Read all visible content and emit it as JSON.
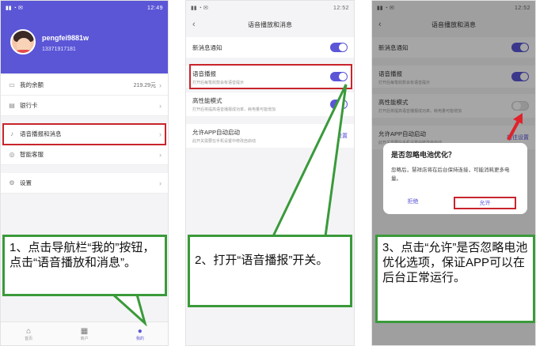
{
  "panel1": {
    "status_time": "12:49",
    "user": {
      "name": "pengfei9881w",
      "phone": "13371917181"
    },
    "menu_group1": [
      {
        "icon": "wallet-icon",
        "label": "我的余额",
        "value": "219.29元"
      },
      {
        "icon": "card-icon",
        "label": "银行卡",
        "value": ""
      }
    ],
    "menu_group2": [
      {
        "icon": "mic-icon",
        "label": "语音播报和消息",
        "value": ""
      },
      {
        "icon": "headset-icon",
        "label": "智能客服",
        "value": ""
      }
    ],
    "menu_group3": [
      {
        "icon": "gear-icon",
        "label": "设置",
        "value": ""
      }
    ],
    "nav": [
      {
        "icon": "home-icon",
        "label": "首页"
      },
      {
        "icon": "shop-icon",
        "label": "商户"
      },
      {
        "icon": "user-icon",
        "label": "我的"
      }
    ],
    "callout": "1、点击导航栏“我的”按钮，点击“语音播放和消息”。"
  },
  "panel2": {
    "status_time": "12:52",
    "title": "语音播放和消息",
    "items": [
      {
        "title": "新消息通知",
        "sub": ""
      },
      {
        "title": "语音播报",
        "sub": "打开后每笔收款会有语音提示"
      },
      {
        "title": "高性能模式",
        "sub": "打开后将提高语音播报成功率，耗电量可能增加"
      },
      {
        "title": "允许APP自动启动",
        "sub": "此开关需要在手机设置中修改自启动",
        "action": "前往设置"
      }
    ],
    "callout": "2、打开“语音播报”开关。"
  },
  "panel3": {
    "status_time": "12:52",
    "title": "语音播放和消息",
    "items": [
      {
        "title": "新消息通知",
        "sub": ""
      },
      {
        "title": "语音播报",
        "sub": "打开后每笔收款会有语音提示"
      },
      {
        "title": "高性能模式",
        "sub": "打开后将提高语音播报成功率，耗电量可能增加"
      },
      {
        "title": "允许APP自动启动",
        "sub": "此开关需要在手机设置中修改自启动",
        "action": "前往设置"
      }
    ],
    "dialog": {
      "title": "是否忽略电池优化？",
      "message": "忽略后，慧祥店将在后台保持连接，可能消耗更多电量。",
      "deny": "拒绝",
      "allow": "允许"
    },
    "callout": "3、点击“允许”是否忽略电池优化选项，保证APP可以在后台正常运行。"
  },
  "colors": {
    "accent": "#5b56d6",
    "highlight": "#c8242b",
    "callout_border": "#3a9a3a"
  }
}
